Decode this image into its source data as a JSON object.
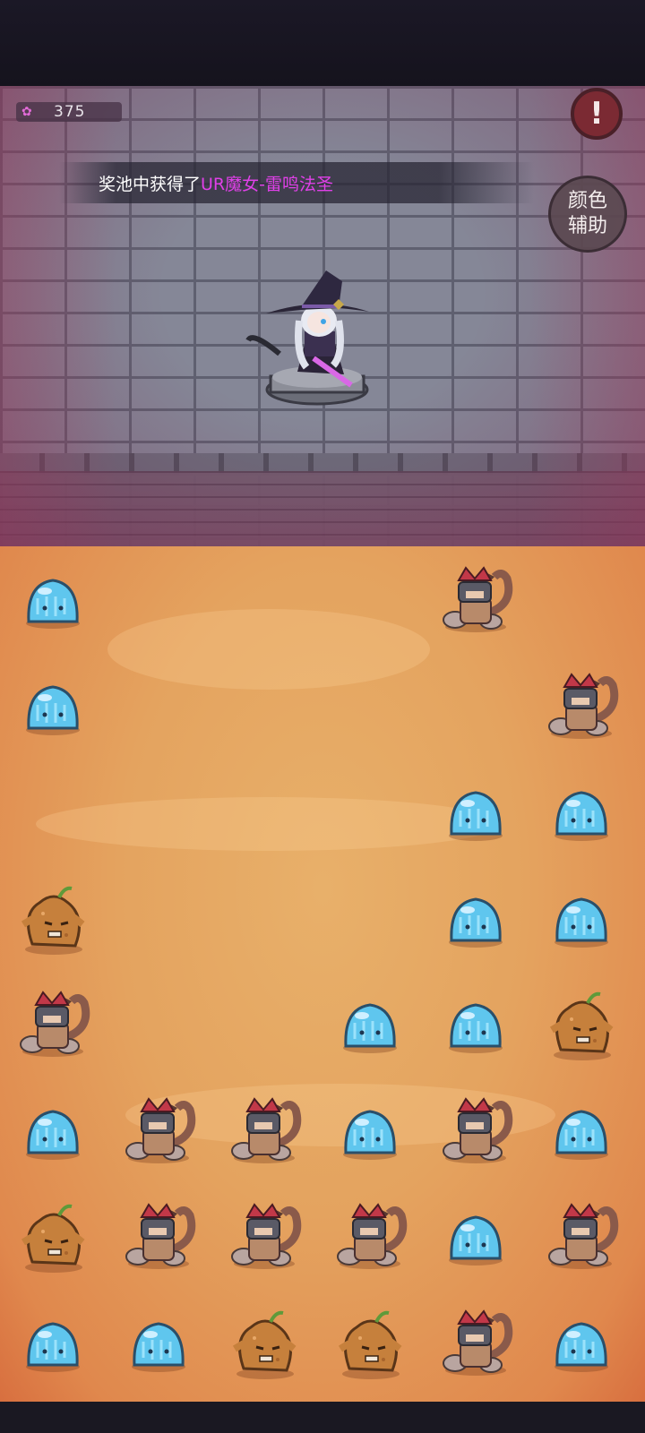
{
  "hud": {
    "currency_icon": "pink-gem-icon",
    "currency_value": "375",
    "alert_label": "!",
    "color_assist_label": "颜色辅助"
  },
  "notice": {
    "prefix": "奖池中获得了",
    "highlight": "UR魔女-雷鸣法圣",
    "highlight_color": "#e040e8"
  },
  "hero": {
    "name": "witch-character"
  },
  "board": {
    "columns": 6,
    "rows": 8,
    "unit_types": {
      "S": "blue-slime",
      "C": "scorpion-warrior",
      "P": "potato-golem"
    },
    "grid": [
      [
        "S",
        "",
        "",
        "",
        "C",
        ""
      ],
      [
        "S",
        "",
        "",
        "",
        "",
        "C"
      ],
      [
        "",
        "",
        "",
        "",
        "S",
        "S"
      ],
      [
        "P",
        "",
        "",
        "",
        "S",
        "S"
      ],
      [
        "C",
        "",
        "",
        "S",
        "S",
        "P"
      ],
      [
        "S",
        "C",
        "C",
        "S",
        "C",
        "S"
      ],
      [
        "P",
        "C",
        "C",
        "C",
        "S",
        "C"
      ],
      [
        "S",
        "S",
        "P",
        "P",
        "C",
        "S"
      ]
    ]
  }
}
